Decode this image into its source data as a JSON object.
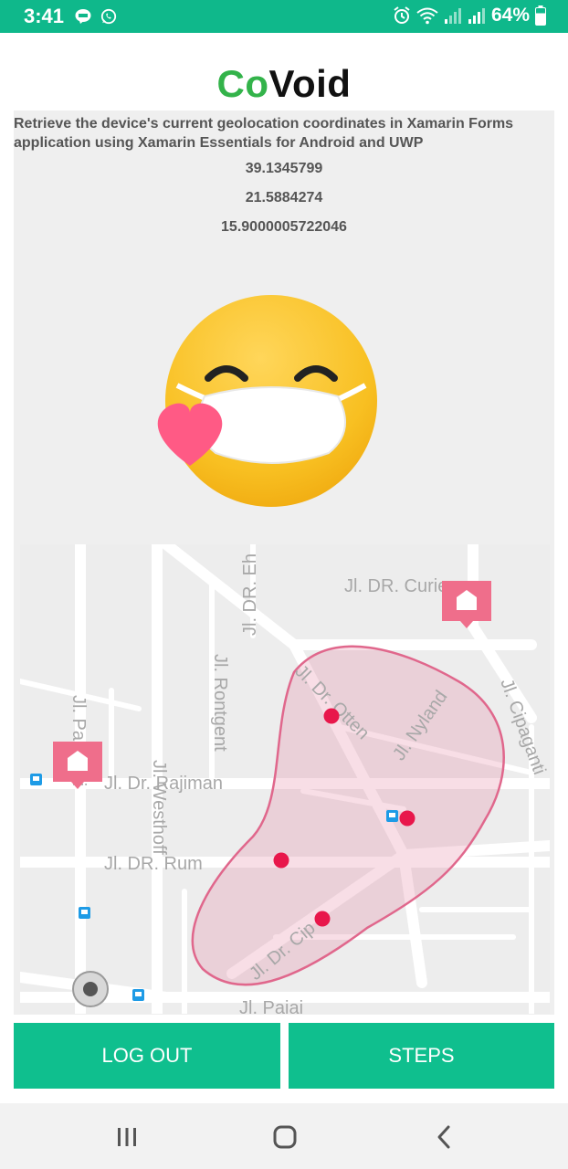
{
  "status_bar": {
    "time": "3:41",
    "battery": "64%",
    "icons": [
      "line-app-icon",
      "whatsapp-icon",
      "alarm-icon",
      "wifi-icon",
      "signal-icon",
      "signal-icon",
      "battery-icon"
    ]
  },
  "app": {
    "logo_part1": "Co",
    "logo_part2": "Void",
    "logo_colors": {
      "co": "#33b34a",
      "void": "#111111"
    }
  },
  "geolocation": {
    "description": "Retrieve the device's current geolocation coordinates in Xamarin Forms application using Xamarin Essentials for Android and UWP",
    "latitude": "39.1345799",
    "longitude": "21.5884274",
    "altitude": "15.9000005722046"
  },
  "map": {
    "street_labels": {
      "curie": "Jl. DR. Curie",
      "eh": "Jl. DR. Eh",
      "westhoff": "Jl. Westhoff",
      "rontgent": "Jl. Rontgent",
      "rajiman": "Jl. Dr. Rajiman",
      "rum": "Jl. DR. Rum",
      "otten": "Jl. Dr. Otten",
      "nyland": "Jl. Nyland",
      "cipaganti": "Jl. Cipaganti",
      "cip": "Jl. Dr. Cip",
      "kaliki": "Jl. Pa kaliki",
      "bottom": "Jl. Pajaj"
    },
    "zone_color": "#e0678c",
    "marker_color": "#e8174b"
  },
  "buttons": {
    "logout": "LOG OUT",
    "steps": "STEPS",
    "color": "#0fbf8e"
  },
  "nav_bar": {
    "items": [
      "recents-icon",
      "home-icon",
      "back-icon"
    ]
  }
}
